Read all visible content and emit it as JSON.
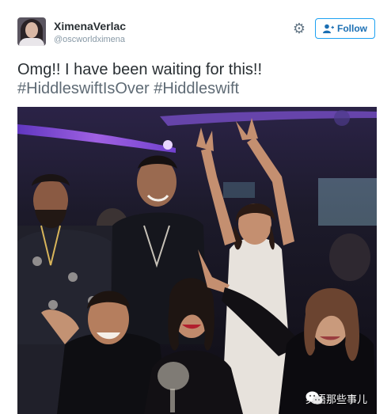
{
  "tweet": {
    "display_name": "XimenaVerlac",
    "handle": "@oscworldximena",
    "follow_label": "Follow",
    "text_line1": "Omg!!  I have been waiting for this!!",
    "text_line2": "#HiddleswiftIsOver  #Hiddleswift"
  },
  "watermark": {
    "label": "英语那些事儿"
  },
  "icons": {
    "settings": "gear-icon",
    "follow": "add-user-icon",
    "watermark": "wechat-icon"
  },
  "colors": {
    "accent": "#1da1f2",
    "text": "#292f33",
    "secondary": "#8899a6"
  }
}
